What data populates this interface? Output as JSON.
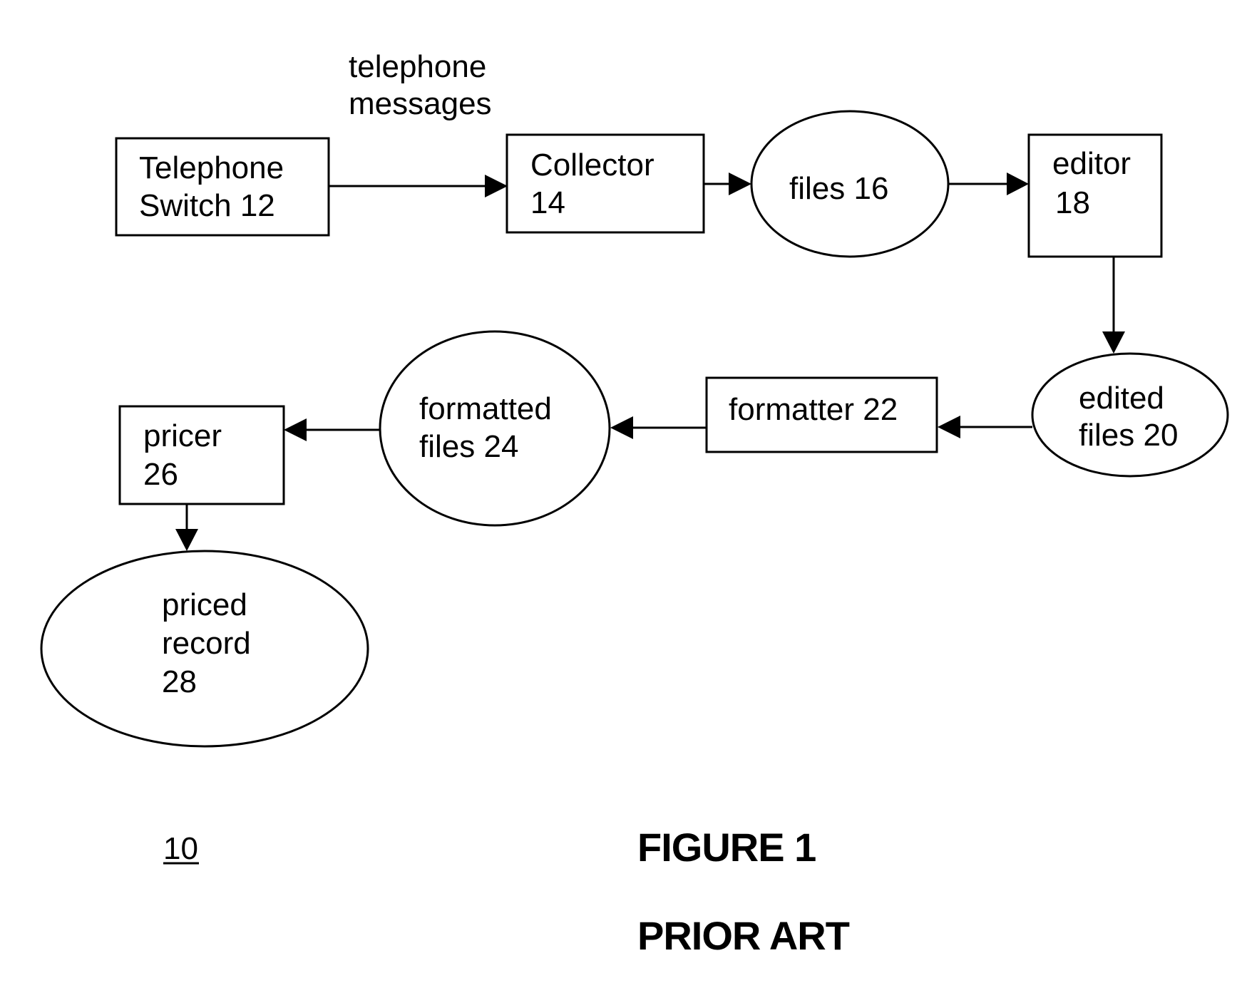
{
  "figure": {
    "title": "FIGURE 1",
    "subtitle": "PRIOR ART",
    "reference_numeral": "10"
  },
  "edge_labels": {
    "switch_to_collector": [
      "telephone",
      "messages"
    ]
  },
  "nodes": {
    "telephone_switch": {
      "shape": "box",
      "lines": [
        "Telephone",
        "Switch 12"
      ]
    },
    "collector": {
      "shape": "box",
      "lines": [
        "Collector",
        "14"
      ]
    },
    "files": {
      "shape": "ellipse",
      "lines": [
        "files 16"
      ]
    },
    "editor": {
      "shape": "box",
      "lines": [
        "editor",
        "18"
      ]
    },
    "edited_files": {
      "shape": "ellipse",
      "lines": [
        "edited",
        "files 20"
      ]
    },
    "formatter": {
      "shape": "box",
      "lines": [
        "formatter 22"
      ]
    },
    "formatted_files": {
      "shape": "ellipse",
      "lines": [
        "formatted",
        "files 24"
      ]
    },
    "pricer": {
      "shape": "box",
      "lines": [
        "pricer",
        "26"
      ]
    },
    "priced_record": {
      "shape": "ellipse",
      "lines": [
        "priced",
        "record",
        "28"
      ]
    }
  },
  "edges": [
    {
      "from": "telephone_switch",
      "to": "collector",
      "label": "telephone messages"
    },
    {
      "from": "collector",
      "to": "files"
    },
    {
      "from": "files",
      "to": "editor"
    },
    {
      "from": "editor",
      "to": "edited_files"
    },
    {
      "from": "edited_files",
      "to": "formatter"
    },
    {
      "from": "formatter",
      "to": "formatted_files"
    },
    {
      "from": "formatted_files",
      "to": "pricer"
    },
    {
      "from": "pricer",
      "to": "priced_record"
    }
  ]
}
